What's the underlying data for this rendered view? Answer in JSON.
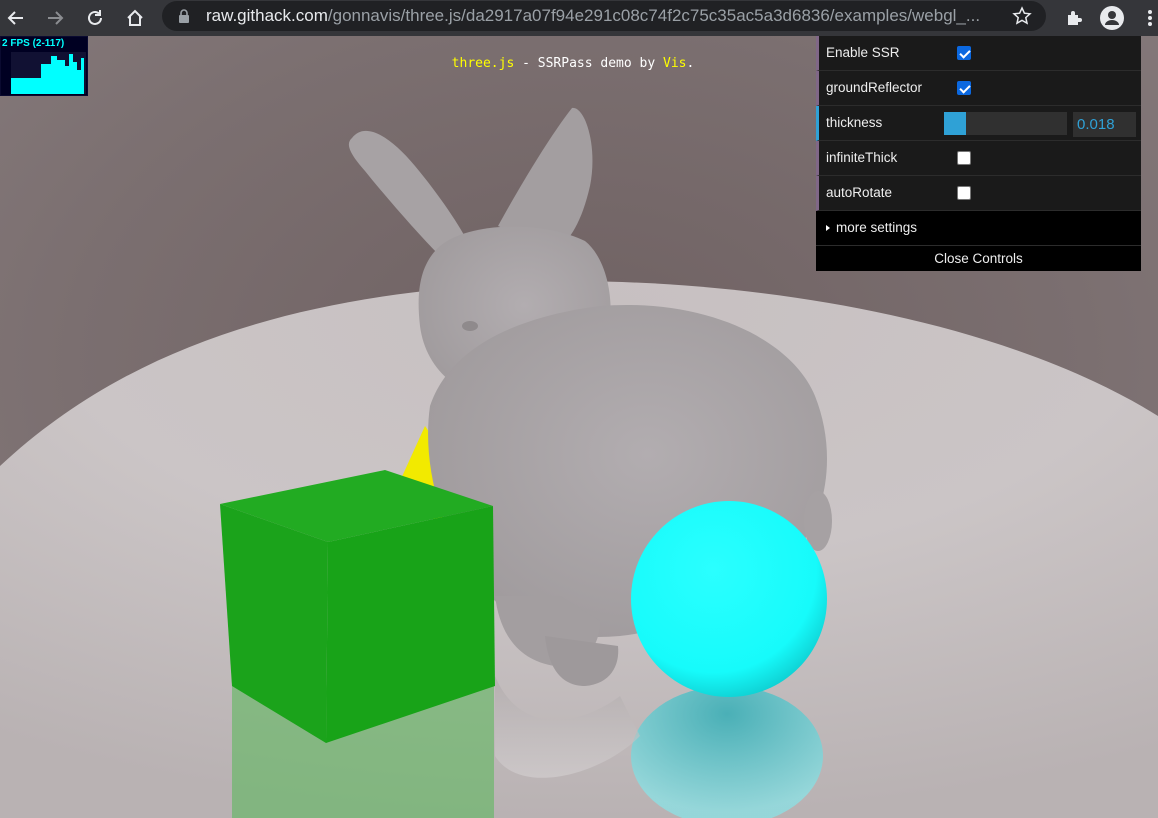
{
  "browser": {
    "url_host": "raw.githack.com",
    "url_path": "/gonnavis/three.js/da2917a07f94e291c08c74f2c75c35ac5a3d6836/examples/webgl_..."
  },
  "stats": {
    "label": "2 FPS (2-117)"
  },
  "scene_title": {
    "part1": "three.js",
    "part2": " - SSRPass demo by ",
    "part3": "Vis",
    "part4": "."
  },
  "gui": {
    "enable_ssr_label": "Enable SSR",
    "enable_ssr_checked": true,
    "ground_reflector_label": "groundReflector",
    "ground_reflector_checked": true,
    "thickness_label": "thickness",
    "thickness_value": "0.018",
    "thickness_fraction": 0.18,
    "infinite_thick_label": "infiniteThick",
    "infinite_thick_checked": false,
    "auto_rotate_label": "autoRotate",
    "auto_rotate_checked": false,
    "more_settings_label": "more settings",
    "close_controls_label": "Close Controls"
  },
  "colors": {
    "toolbar": "#35363a",
    "gui_background": "#1a1a1a",
    "number_accent": "#2fa1d6",
    "cube": "#1ca51c",
    "sphere": "#1affff",
    "cone": "#f2ea00",
    "bunny": "#a8a3a5"
  }
}
